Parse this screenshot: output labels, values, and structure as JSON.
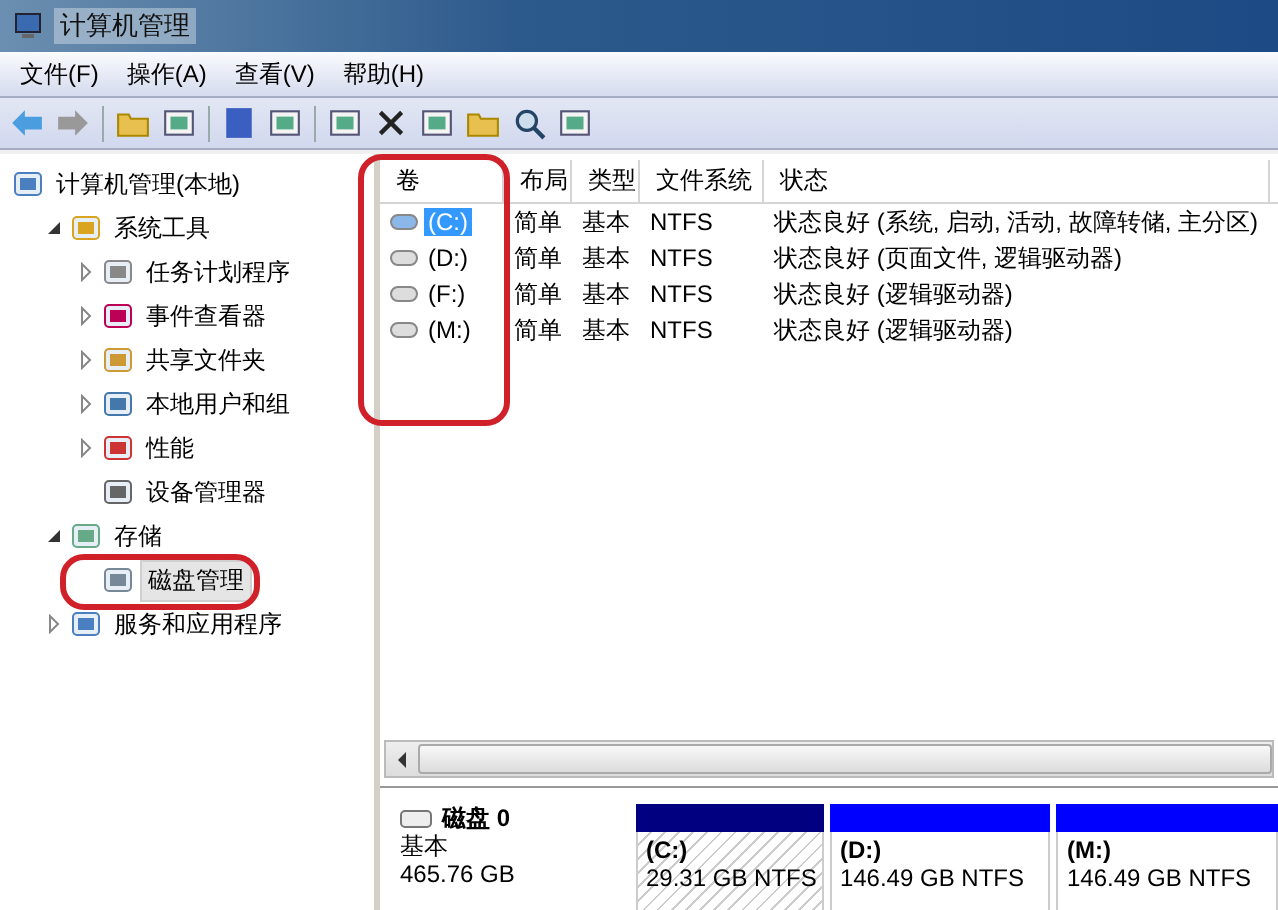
{
  "window": {
    "title": "计算机管理"
  },
  "menu": [
    "文件(F)",
    "操作(A)",
    "查看(V)",
    "帮助(H)"
  ],
  "tree": {
    "label": "计算机管理(本地)",
    "children": [
      {
        "label": "系统工具",
        "expanded": true,
        "selected": false,
        "children": [
          {
            "label": "任务计划程序",
            "expanded": false,
            "selected": false
          },
          {
            "label": "事件查看器",
            "expanded": false,
            "selected": false
          },
          {
            "label": "共享文件夹",
            "expanded": false,
            "selected": false
          },
          {
            "label": "本地用户和组",
            "expanded": false,
            "selected": false
          },
          {
            "label": "性能",
            "expanded": false,
            "selected": false
          },
          {
            "label": "设备管理器",
            "selected": false
          }
        ]
      },
      {
        "label": "存储",
        "expanded": true,
        "selected": false,
        "children": [
          {
            "label": "磁盘管理",
            "selected": true
          }
        ]
      },
      {
        "label": "服务和应用程序",
        "expanded": false,
        "selected": false
      }
    ]
  },
  "volumes": {
    "columns": [
      "卷",
      "布局",
      "类型",
      "文件系统",
      "状态"
    ],
    "rows": [
      {
        "volume": "(C:)",
        "layout": "简单",
        "type": "基本",
        "fs": "NTFS",
        "status": "状态良好 (系统, 启动, 活动, 故障转储, 主分区)",
        "selected": true
      },
      {
        "volume": "(D:)",
        "layout": "简单",
        "type": "基本",
        "fs": "NTFS",
        "status": "状态良好 (页面文件, 逻辑驱动器)",
        "selected": false
      },
      {
        "volume": "(F:)",
        "layout": "简单",
        "type": "基本",
        "fs": "NTFS",
        "status": "状态良好 (逻辑驱动器)",
        "selected": false
      },
      {
        "volume": "(M:)",
        "layout": "简单",
        "type": "基本",
        "fs": "NTFS",
        "status": "状态良好 (逻辑驱动器)",
        "selected": false
      }
    ]
  },
  "disk": {
    "name": "磁盘 0",
    "type": "基本",
    "size": "465.76 GB",
    "partitions": [
      {
        "label": "(C:)",
        "info": "29.31 GB NTFS",
        "kind": "primary",
        "selected": true
      },
      {
        "label": "(D:)",
        "info": "146.49 GB NTFS",
        "kind": "logical",
        "selected": false
      },
      {
        "label": "(M:)",
        "info": "146.49 GB NTFS",
        "kind": "logical",
        "selected": false
      }
    ]
  }
}
